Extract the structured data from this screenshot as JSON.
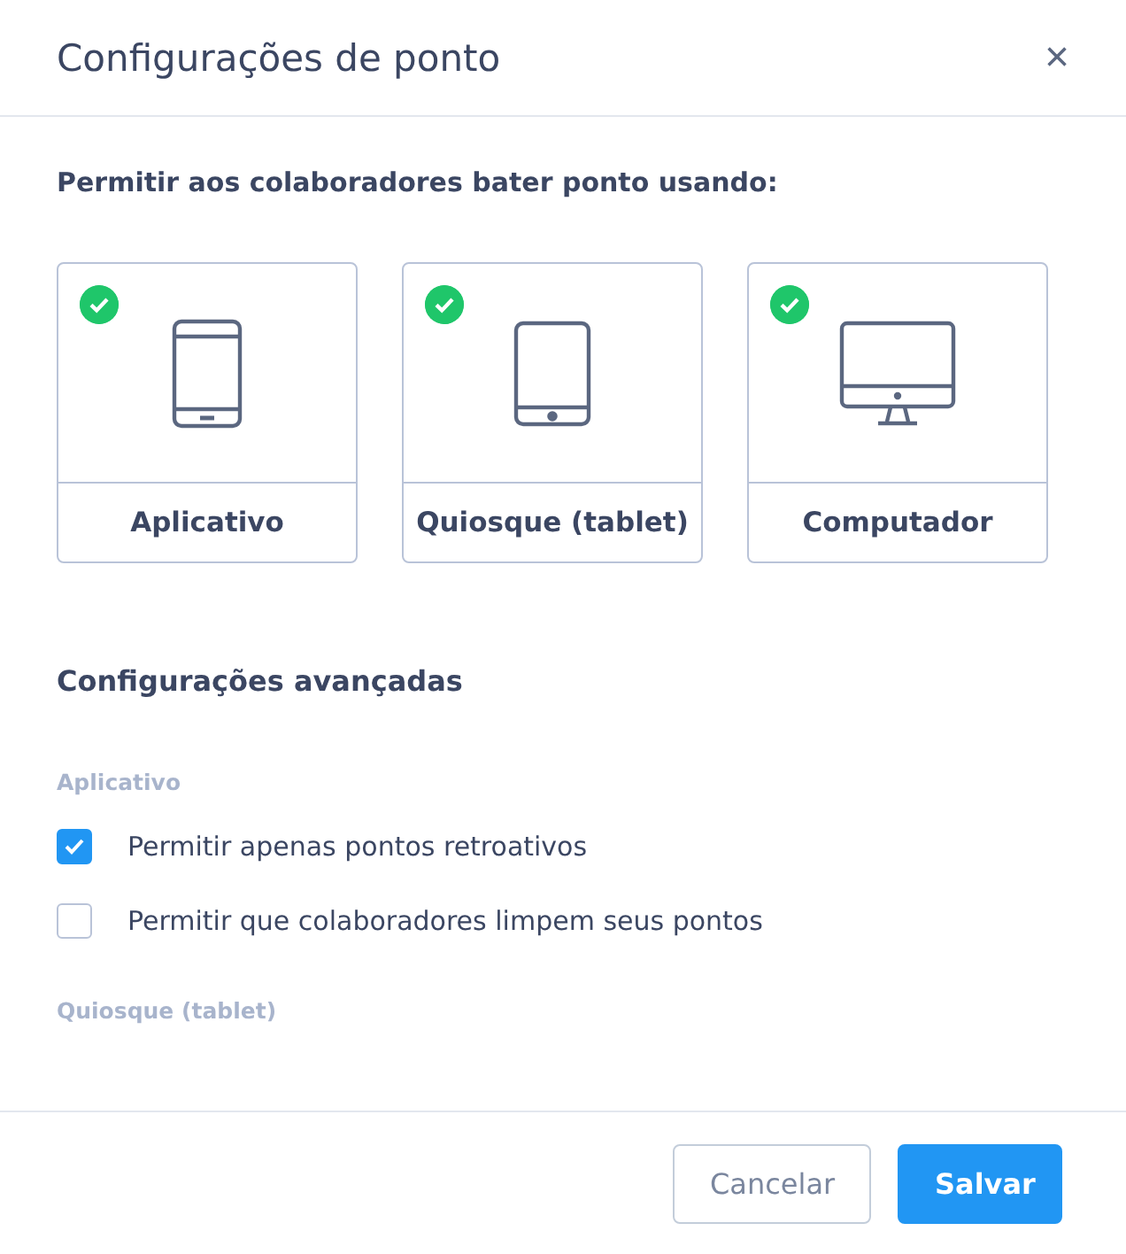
{
  "dialog": {
    "title": "Configurações de ponto",
    "close": "×"
  },
  "prompt": "Permitir aos colaboradores bater ponto usando:",
  "methods": [
    {
      "label": "Aplicativo",
      "kind": "phone",
      "selected": true
    },
    {
      "label": "Quiosque (tablet)",
      "kind": "tablet",
      "selected": true
    },
    {
      "label": "Computador",
      "kind": "monitor",
      "selected": true
    }
  ],
  "advanced": {
    "title": "Configurações avançadas",
    "groups": [
      {
        "title": "Aplicativo",
        "options": [
          {
            "label": "Permitir apenas pontos retroativos",
            "checked": true
          },
          {
            "label": "Permitir que colaboradores limpem seus pontos",
            "checked": false
          }
        ]
      },
      {
        "title": "Quiosque (tablet)"
      }
    ]
  },
  "buttons": [
    {
      "label": "Cancelar",
      "kind": "secondary"
    },
    {
      "label": "Salvar",
      "kind": "primary"
    }
  ]
}
